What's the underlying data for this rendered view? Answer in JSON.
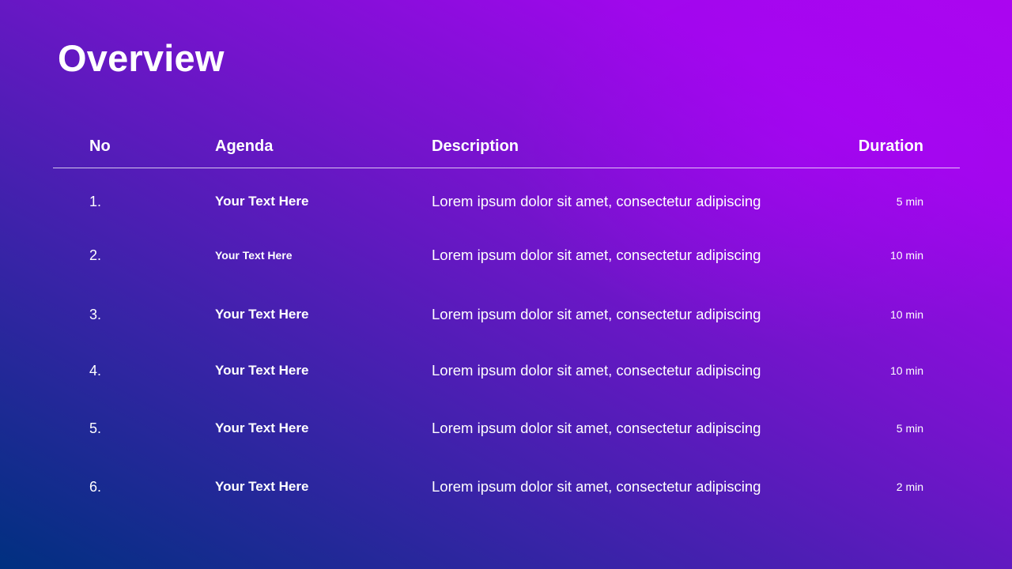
{
  "slide": {
    "title": "Overview",
    "colors": {
      "gradient_start": "#003080",
      "gradient_end": "#ab05f0",
      "text": "#ffffff"
    }
  },
  "table": {
    "headers": {
      "no": "No",
      "agenda": "Agenda",
      "description": "Description",
      "duration": "Duration"
    },
    "rows": [
      {
        "no": "1.",
        "agenda": "Your Text Here",
        "description": "Lorem ipsum dolor sit amet, consectetur adipiscing",
        "duration": "5 min"
      },
      {
        "no": "2.",
        "agenda": "Your Text Here",
        "description": "Lorem ipsum dolor sit amet, consectetur adipiscing",
        "duration": "10 min"
      },
      {
        "no": "3.",
        "agenda": "Your Text Here",
        "description": "Lorem ipsum dolor sit amet, consectetur adipiscing",
        "duration": "10 min"
      },
      {
        "no": "4.",
        "agenda": "Your Text Here",
        "description": "Lorem ipsum dolor sit amet, consectetur adipiscing",
        "duration": "10 min"
      },
      {
        "no": "5.",
        "agenda": "Your Text Here",
        "description": "Lorem ipsum dolor sit amet, consectetur adipiscing",
        "duration": "5 min"
      },
      {
        "no": "6.",
        "agenda": "Your Text Here",
        "description": "Lorem ipsum dolor sit amet, consectetur adipiscing",
        "duration": "2 min"
      }
    ]
  }
}
